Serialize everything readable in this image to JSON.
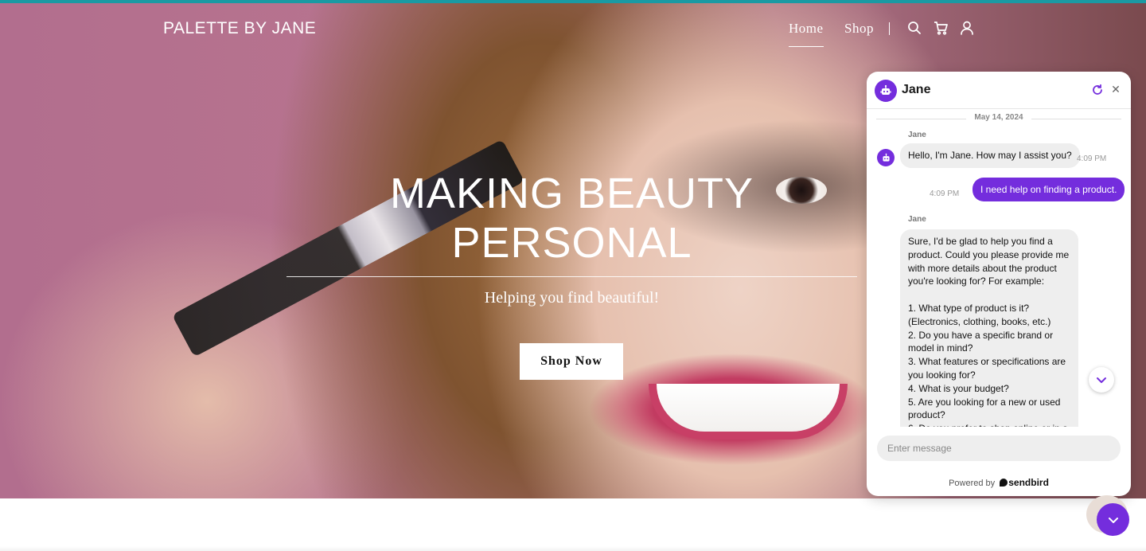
{
  "site": {
    "brand": "PALETTE BY JANE",
    "nav": {
      "home": "Home",
      "shop": "Shop"
    },
    "icons": [
      "search-icon",
      "cart-icon",
      "user-icon"
    ],
    "accent_bar_color": "#1a9aa3"
  },
  "hero": {
    "headline_line1": "MAKING BEAUTY",
    "headline_line2": "PERSONAL",
    "subtitle": "Helping you find beautiful!",
    "cta": "Shop Now"
  },
  "chat": {
    "title": "Jane",
    "accent_color": "#742ddd",
    "date": "May 14, 2024",
    "messages": [
      {
        "from": "bot",
        "sender": "Jane",
        "text": "Hello, I'm Jane. How may I assist you?",
        "time": "4:09 PM"
      },
      {
        "from": "user",
        "text": "I need help on finding a product.",
        "time": "4:09 PM"
      },
      {
        "from": "bot",
        "sender": "Jane",
        "text": "Sure, I'd be glad to help you find a product. Could you please provide me with more details about the product you're looking for? For example:\n\n1. What type of product is it? (Electronics, clothing, books, etc.)\n2. Do you have a specific brand or model in mind?\n3. What features or specifications are you looking for?\n4. What is your budget?\n5. Are you looking for a new or used product?\n6. Do you prefer to shop online or in a"
      }
    ],
    "input_placeholder": "Enter message",
    "powered_prefix": "Powered by",
    "powered_brand": "sendbird"
  }
}
